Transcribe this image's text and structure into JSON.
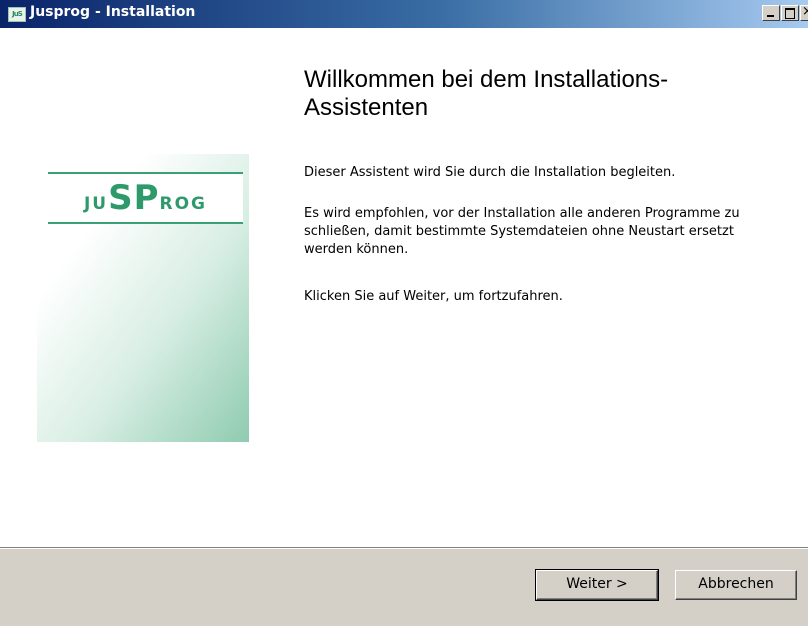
{
  "window": {
    "title": "Jusprog - Installation",
    "icon": "jusprog-app-icon",
    "icon_text": "JuS"
  },
  "titlebar_buttons": {
    "minimize": "minimize-icon",
    "maximize": "maximize-icon",
    "close": "close-icon",
    "close_glyph": "×"
  },
  "logo": {
    "text_left": "JU",
    "text_mid": "SP",
    "text_right": "ROG"
  },
  "content": {
    "heading": "Willkommen bei dem Installations-Assistenten",
    "paragraph1": "Dieser Assistent wird Sie durch die Installation begleiten.",
    "paragraph2": "Es wird empfohlen, vor der Installation alle anderen Programme zu schließen, damit bestimmte Systemdateien ohne Neustart ersetzt werden können.",
    "paragraph3": "Klicken Sie auf Weiter, um fortzufahren."
  },
  "buttons": {
    "next": "Weiter >",
    "cancel": "Abbrechen"
  },
  "colors": {
    "titlebar_start": "#0a246a",
    "titlebar_end": "#a6caf0",
    "logo_green": "#2e9a6b",
    "panel_bg": "#d4d0c8"
  }
}
